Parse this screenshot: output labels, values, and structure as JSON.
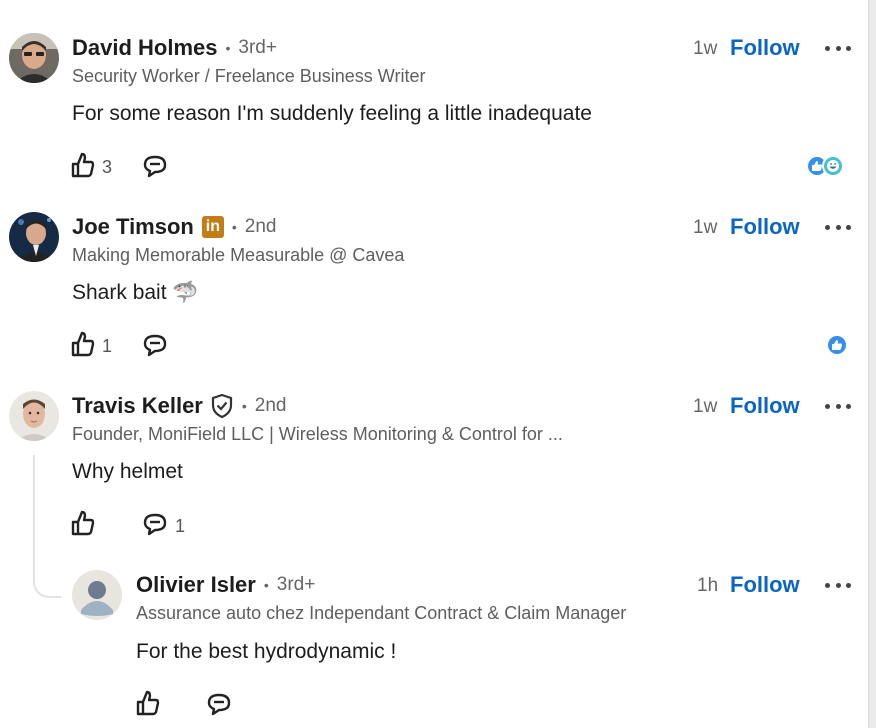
{
  "colors": {
    "accent": "#0a66c2",
    "text": "#1d1d1d",
    "muted": "#666666",
    "linkedin_badge": "#c37d16"
  },
  "comments": [
    {
      "name": "David Holmes",
      "degree": "3rd+",
      "headline": "Security Worker / Freelance Business Writer",
      "time": "1w",
      "follow_label": "Follow",
      "text": "For some reason I'm suddenly feeling a little inadequate",
      "like_count": "3",
      "reply_count": "",
      "reactions": [
        "like-reaction-icon",
        "funny-reaction-icon"
      ]
    },
    {
      "name": "Joe Timson",
      "badge": "in",
      "degree": "2nd",
      "headline": "Making Memorable Measurable @ Cavea",
      "time": "1w",
      "follow_label": "Follow",
      "text": "Shark bait 🦈",
      "like_count": "1",
      "reply_count": "",
      "reactions": [
        "like-reaction-icon"
      ]
    },
    {
      "name": "Travis Keller",
      "verified": true,
      "degree": "2nd",
      "headline": "Founder, MoniField LLC | Wireless Monitoring & Control for ...",
      "time": "1w",
      "follow_label": "Follow",
      "text": "Why helmet",
      "like_count": "",
      "reply_count": "1",
      "reactions": []
    },
    {
      "name": "Olivier Isler",
      "degree": "3rd+",
      "headline": "Assurance auto chez Independant Contract & Claim Manager",
      "time": "1h",
      "follow_label": "Follow",
      "text": "For the best hydrodynamic !",
      "like_count": "",
      "reply_count": "",
      "reactions": []
    }
  ]
}
